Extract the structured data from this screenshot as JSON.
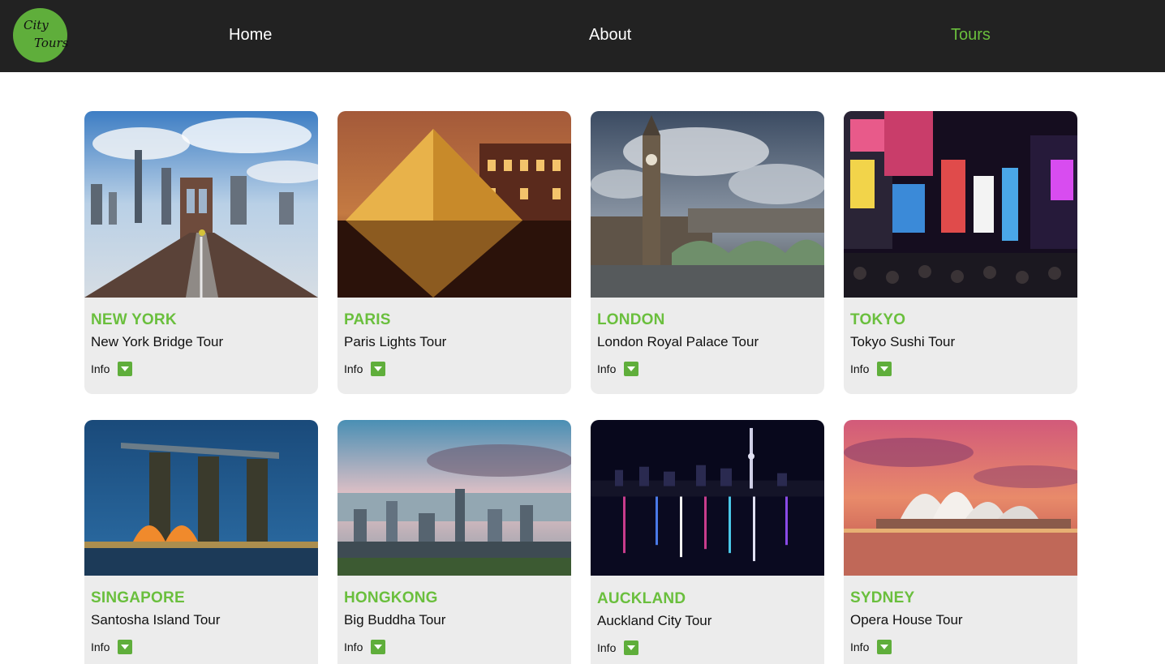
{
  "nav": {
    "logo_line1": "City",
    "logo_line2": "Tours",
    "links": [
      {
        "label": "Home"
      },
      {
        "label": "About"
      },
      {
        "label": "Tours"
      }
    ]
  },
  "tours": [
    {
      "city": "NEW YORK",
      "tour": "New York Bridge Tour",
      "info": "Info"
    },
    {
      "city": "PARIS",
      "tour": "Paris Lights Tour",
      "info": "Info"
    },
    {
      "city": "LONDON",
      "tour": "London Royal Palace Tour",
      "info": "Info"
    },
    {
      "city": "TOKYO",
      "tour": "Tokyo Sushi Tour",
      "info": "Info"
    },
    {
      "city": "SINGAPORE",
      "tour": "Santosha Island Tour",
      "info": "Info"
    },
    {
      "city": "HONGKONG",
      "tour": "Big Buddha Tour",
      "info": "Info"
    },
    {
      "city": "AUCKLAND",
      "tour": "Auckland City Tour",
      "info": "Info"
    },
    {
      "city": "SYDNEY",
      "tour": "Opera House Tour",
      "info": "Info"
    }
  ],
  "colors": {
    "accent": "#6abf3d",
    "nav_bg": "#222222",
    "card_bg": "#ececec"
  },
  "icons": {
    "info_toggle": "caret-down-icon"
  }
}
